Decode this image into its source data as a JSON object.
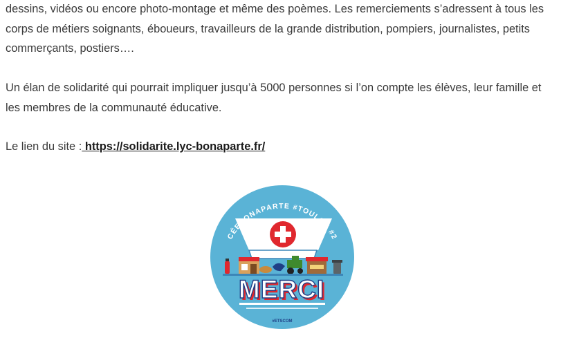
{
  "article": {
    "paragraph1": "dessins, vidéos ou encore photo-montage et même des poèmes. Les remerciements s’adressent à tous les corps de métiers soignants, éboueurs, travailleurs de la grande distribution, pompiers, journalistes, petits commerçants, postiers….",
    "paragraph2": "Un élan de solidarité qui pourrait impliquer jusqu’à 5000 personnes si l’on compte les élèves, leur famille et les membres de la communauté éducative.",
    "link_prefix": "Le lien du site :",
    "link_text": " https://solidarite.lyc-bonaparte.fr/"
  },
  "badge": {
    "arc_text": "#LYCÉEBONAPARTE #TOULON #2020",
    "main_word": "MERCI",
    "credit": "#ETSCOM",
    "icons": [
      "fire-extinguisher-icon",
      "shop-icon",
      "bread-icon",
      "bird-icon",
      "tractor-icon",
      "market-stall-icon",
      "trash-bin-icon"
    ],
    "colors": {
      "circle": "#5ab3d6",
      "cap": "#ffffff",
      "cross": "#e0282e",
      "merci_fill": "#ffffff",
      "merci_shadow": "#e0282e",
      "merci_outline": "#1f3f86"
    }
  }
}
